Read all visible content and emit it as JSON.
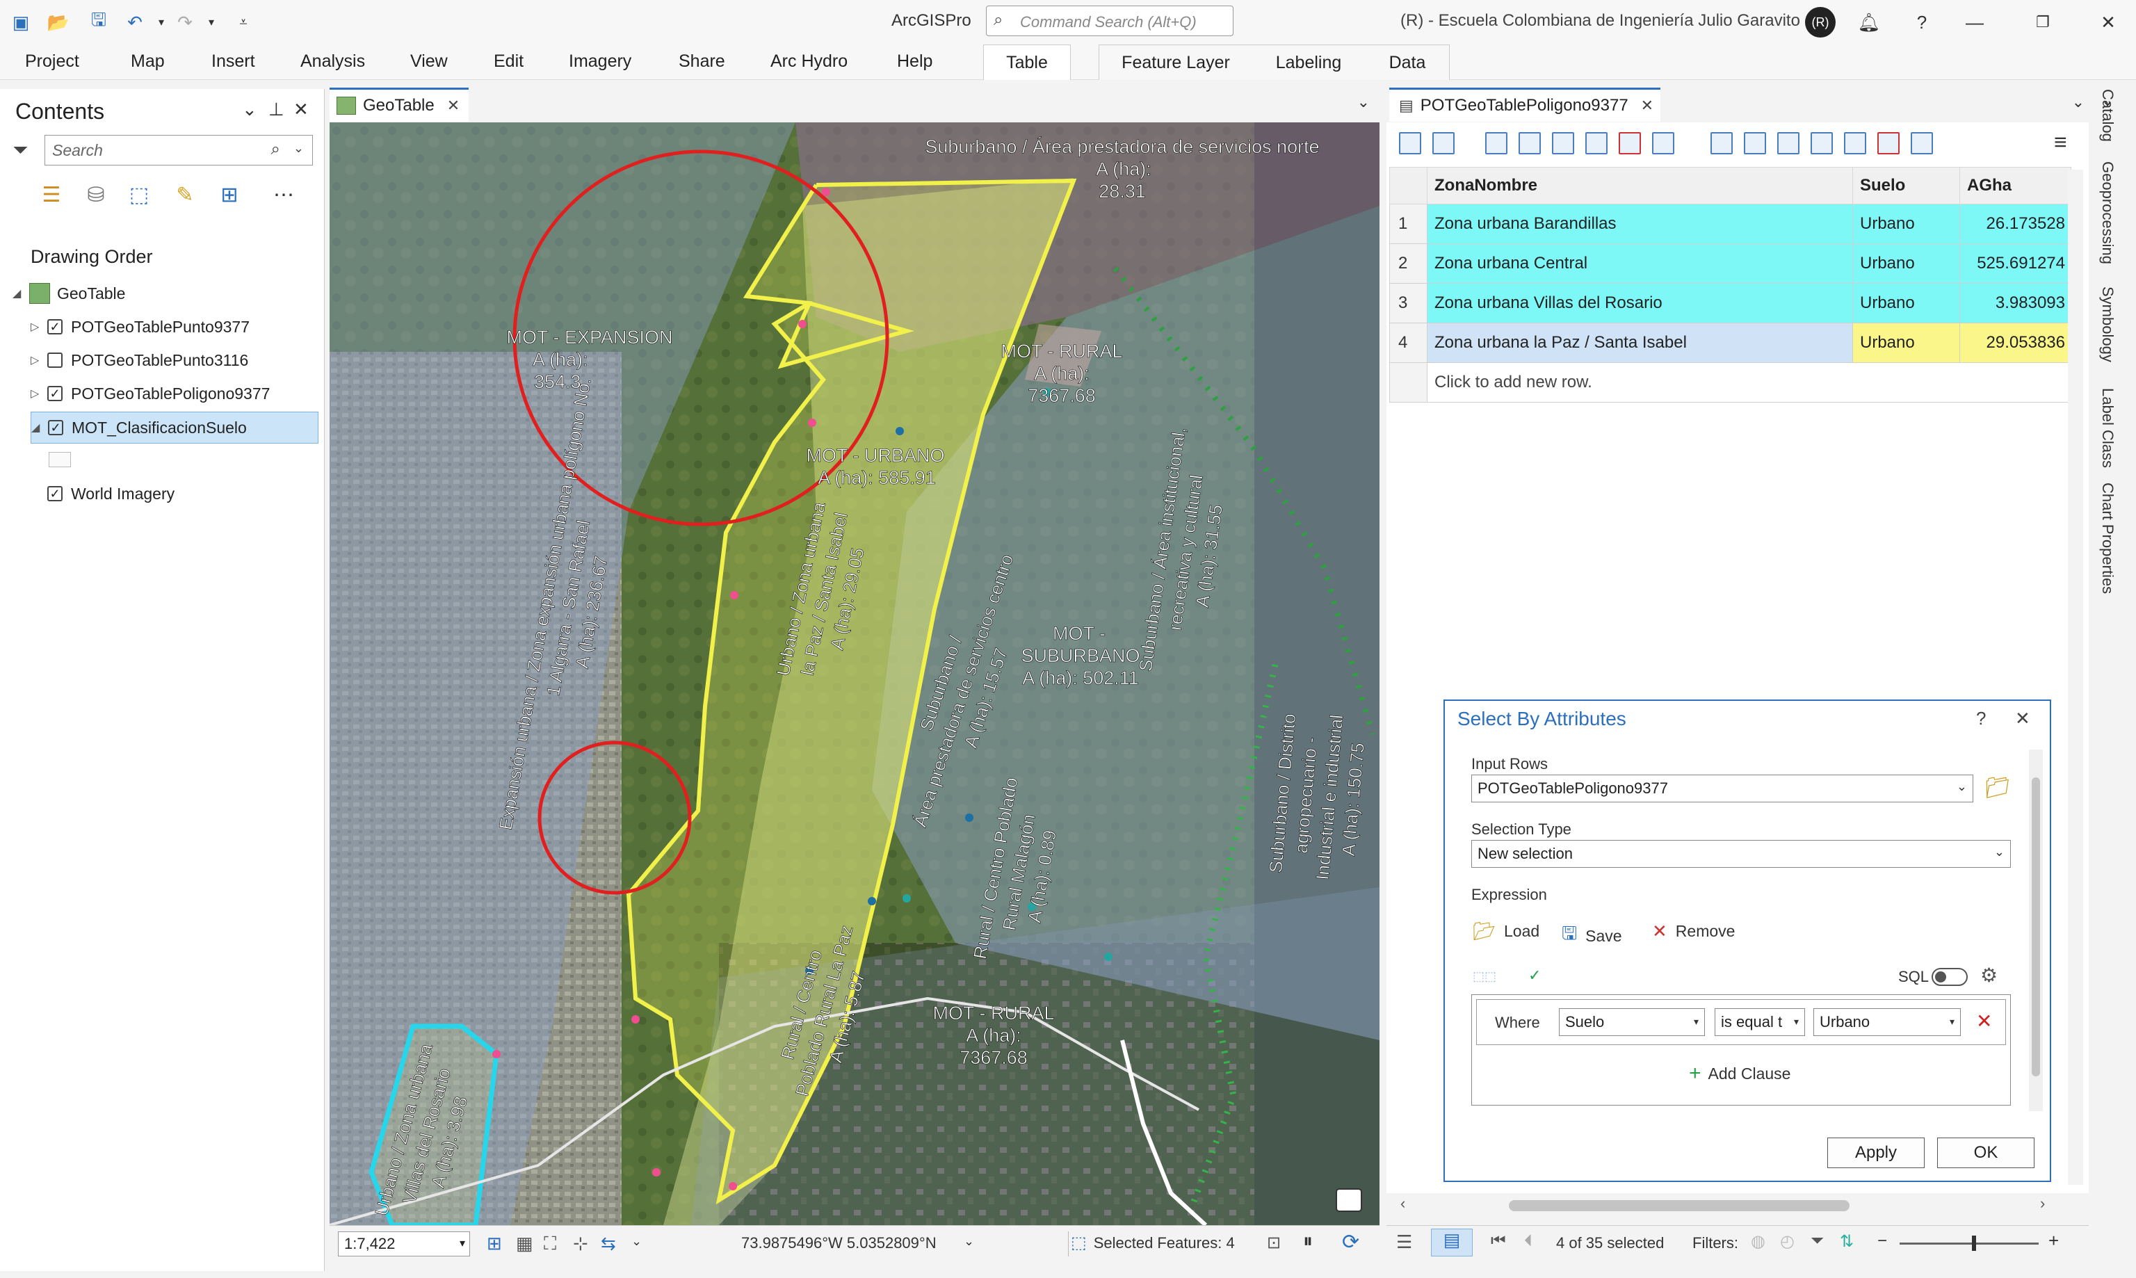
{
  "app": {
    "title": "ArcGISPro",
    "command_search_placeholder": "Command Search (Alt+Q)",
    "organization": "(R) - Escuela Colombiana de Ingeniería Julio Garavito",
    "user_initials": "(R)"
  },
  "ribbon": {
    "tabs": [
      "Project",
      "Map",
      "Insert",
      "Analysis",
      "View",
      "Edit",
      "Imagery",
      "Share",
      "Arc Hydro",
      "Help"
    ],
    "context_tabs": [
      "Table",
      "Feature Layer",
      "Labeling",
      "Data"
    ]
  },
  "contents": {
    "title": "Contents",
    "search_placeholder": "Search",
    "drawing_order_label": "Drawing Order",
    "map_name": "GeoTable",
    "layers": [
      {
        "name": "POTGeoTablePunto9377",
        "checked": true
      },
      {
        "name": "POTGeoTablePunto3116",
        "checked": false
      },
      {
        "name": "POTGeoTablePoligono9377",
        "checked": true
      },
      {
        "name": "MOT_ClasificacionSuelo",
        "checked": true
      },
      {
        "name": "World Imagery",
        "checked": true
      }
    ]
  },
  "map_view": {
    "tab_label": "GeoTable",
    "labels": {
      "norte_1": "Suburbano / Área prestadora de servicios norte",
      "norte_2": "A (ha):",
      "norte_3": "28.31",
      "expansion_1": "MOT - EXPANSION",
      "expansion_2": "A (ha):",
      "expansion_3": "354.3",
      "urbano_1": "MOT - URBANO",
      "urbano_2": "A (ha): 585.91",
      "sta_isabel_1": "Rural / Centro Poblado",
      "sta_isabel_2": "Rural Santa Isabel",
      "sta_isabel_3": "A (ha): 2.1",
      "algarra_1": "Expansión urbana / Zona expansión urbana polígono No.",
      "algarra_2": "1 Algarra - San Rafael",
      "algarra_3": "A (ha): 236.67",
      "paz_1": "Urbano / Zona urbana",
      "paz_2": "la Paz / Santa Isabel",
      "paz_3": "A (ha): 29.05",
      "centro_1": "Suburbano /",
      "centro_2": "Área prestadora de servicios centro",
      "centro_3": "A (ha): 15.57",
      "sub_1": "MOT -",
      "sub_2": "SUBURBANO",
      "sub_3": "A (ha): 502.11",
      "inst_1": "Suburbano / Área institucional,",
      "inst_2": "recreativa y cultural",
      "inst_3": "A (ha): 31.55",
      "malagon_1": "Rural / Centro Poblado",
      "malagon_2": "Rural Malagón",
      "malagon_3": "A (ha): 0.89",
      "lapaz_1": "Rural / Centro",
      "lapaz_2": "Poblado Rural La Paz",
      "lapaz_3": "A (ha): 5.87",
      "rural_1": "MOT - RURAL",
      "rural_2": "A (ha):",
      "rural_3": "7367.68",
      "distrito_1": "Suburbano / Distrito",
      "distrito_2": "agropecuario -",
      "distrito_3": "Industrial e industrial",
      "distrito_4": "A (ha): 150.75",
      "rosario_1": "Urbano / Zona urbana",
      "rosario_2": "Villas del Rosario",
      "rosario_3": "A (ha): 3.98"
    },
    "status": {
      "scale": "1:7,422",
      "coordinates": "73.9875496°W 5.0352809°N",
      "selected_features": "Selected Features: 4"
    }
  },
  "table_view": {
    "tab_label": "POTGeoTablePoligono9377",
    "columns": [
      "ZonaNombre",
      "Suelo",
      "AGha"
    ],
    "rows": [
      {
        "n": "1",
        "ZonaNombre": "Zona urbana Barandillas",
        "Suelo": "Urbano",
        "AGha": "26.173528"
      },
      {
        "n": "2",
        "ZonaNombre": "Zona urbana Central",
        "Suelo": "Urbano",
        "AGha": "525.691274"
      },
      {
        "n": "3",
        "ZonaNombre": "Zona urbana Villas del Rosario",
        "Suelo": "Urbano",
        "AGha": "3.983093"
      },
      {
        "n": "4",
        "ZonaNombre": "Zona urbana la Paz / Santa Isabel",
        "Suelo": "Urbano",
        "AGha": "29.053836"
      }
    ],
    "add_row_text": "Click to add new row.",
    "status": {
      "selected_count": "4 of 35 selected",
      "filters_label": "Filters:"
    }
  },
  "right_dock": {
    "tabs": [
      "Catalog",
      "Geoprocessing",
      "Symbology",
      "Label Class",
      "Chart Properties"
    ]
  },
  "select_by_attributes": {
    "title": "Select By Attributes",
    "input_rows_label": "Input Rows",
    "input_rows_value": "POTGeoTablePoligono9377",
    "selection_type_label": "Selection Type",
    "selection_type_value": "New selection",
    "expression_label": "Expression",
    "load_label": "Load",
    "save_label": "Save",
    "remove_label": "Remove",
    "sql_label": "SQL",
    "clause": {
      "where": "Where",
      "field": "Suelo",
      "operator": "is equal t",
      "value": "Urbano"
    },
    "add_clause_label": "Add Clause",
    "apply_label": "Apply",
    "ok_label": "OK"
  }
}
